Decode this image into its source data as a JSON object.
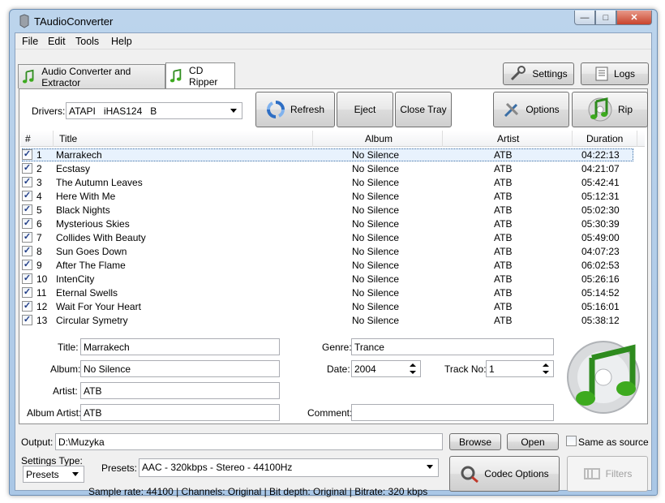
{
  "window": {
    "title": "TAudioConverter"
  },
  "menu": [
    "File",
    "Edit",
    "Tools",
    "Help"
  ],
  "tabs": [
    {
      "label": "Audio Converter and Extractor",
      "active": false
    },
    {
      "label": "CD Ripper",
      "active": true
    }
  ],
  "top_buttons": {
    "settings": "Settings",
    "logs": "Logs"
  },
  "drivers": {
    "label": "Drivers:",
    "value": "ATAPI   iHAS124   B"
  },
  "toolbar": {
    "refresh": "Refresh",
    "eject": "Eject",
    "close_tray": "Close Tray",
    "options": "Options",
    "rip": "Rip"
  },
  "columns": [
    "#",
    "Title",
    "Album",
    "Artist",
    "Duration"
  ],
  "tracks": [
    {
      "num": "1",
      "title": "Marrakech",
      "album": "No Silence",
      "artist": "ATB",
      "duration": "04:22:13",
      "checked": true
    },
    {
      "num": "2",
      "title": "Ecstasy",
      "album": "No Silence",
      "artist": "ATB",
      "duration": "04:21:07",
      "checked": true
    },
    {
      "num": "3",
      "title": "The Autumn Leaves",
      "album": "No Silence",
      "artist": "ATB",
      "duration": "05:42:41",
      "checked": true
    },
    {
      "num": "4",
      "title": "Here With Me",
      "album": "No Silence",
      "artist": "ATB",
      "duration": "05:12:31",
      "checked": true
    },
    {
      "num": "5",
      "title": "Black Nights",
      "album": "No Silence",
      "artist": "ATB",
      "duration": "05:02:30",
      "checked": true
    },
    {
      "num": "6",
      "title": "Mysterious Skies",
      "album": "No Silence",
      "artist": "ATB",
      "duration": "05:30:39",
      "checked": true
    },
    {
      "num": "7",
      "title": "Collides With Beauty",
      "album": "No Silence",
      "artist": "ATB",
      "duration": "05:49:00",
      "checked": true
    },
    {
      "num": "8",
      "title": "Sun Goes Down",
      "album": "No Silence",
      "artist": "ATB",
      "duration": "04:07:23",
      "checked": true
    },
    {
      "num": "9",
      "title": "After The Flame",
      "album": "No Silence",
      "artist": "ATB",
      "duration": "06:02:53",
      "checked": true
    },
    {
      "num": "10",
      "title": "IntenCity",
      "album": "No Silence",
      "artist": "ATB",
      "duration": "05:26:16",
      "checked": true
    },
    {
      "num": "11",
      "title": "Eternal Swells",
      "album": "No Silence",
      "artist": "ATB",
      "duration": "05:14:52",
      "checked": true
    },
    {
      "num": "12",
      "title": "Wait For Your Heart",
      "album": "No Silence",
      "artist": "ATB",
      "duration": "05:16:01",
      "checked": true
    },
    {
      "num": "13",
      "title": "Circular Symetry",
      "album": "No Silence",
      "artist": "ATB",
      "duration": "05:38:12",
      "checked": true
    }
  ],
  "selected_track_index": 0,
  "tags": {
    "title_label": "Title:",
    "title": "Marrakech",
    "album_label": "Album:",
    "album": "No Silence",
    "artist_label": "Artist:",
    "artist": "ATB",
    "album_artist_label": "Album Artist:",
    "album_artist": "ATB",
    "genre_label": "Genre:",
    "genre": "Trance",
    "date_label": "Date:",
    "date": "2004",
    "track_no_label": "Track No:",
    "track_no": "1",
    "comment_label": "Comment:",
    "comment": ""
  },
  "output": {
    "label": "Output:",
    "path": "D:\\Muzyka",
    "browse": "Browse",
    "open": "Open",
    "same_as_source": "Same as source"
  },
  "settings_type": {
    "label": "Settings Type:",
    "value": "Presets"
  },
  "presets": {
    "label": "Presets:",
    "value": "AAC - 320kbps - Stereo - 44100Hz"
  },
  "info_line": "Sample rate: 44100 | Channels: Original | Bit depth: Original | Bitrate: 320 kbps",
  "codec_options": "Codec Options",
  "filters": "Filters",
  "colors": {
    "accent": "#3a6ea5",
    "note_green": "#3daa1e"
  }
}
